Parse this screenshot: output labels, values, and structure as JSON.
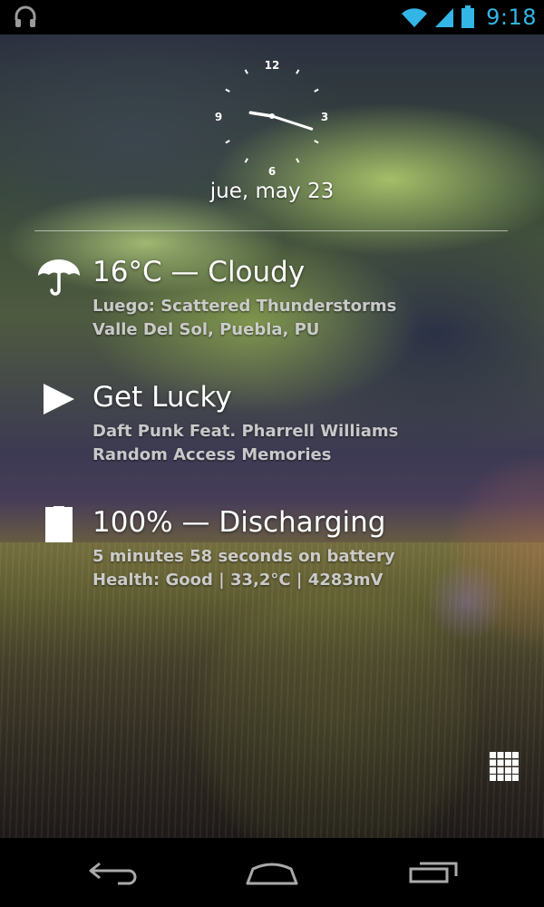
{
  "status_bar": {
    "left_icon": "headphones-icon",
    "right_icons": [
      "wifi-icon",
      "signal-icon",
      "battery-icon"
    ],
    "time": "9:18",
    "accent_color": "#33b5e5"
  },
  "clock": {
    "numbers": [
      "12",
      "3",
      "6",
      "9"
    ],
    "hour": 9,
    "minute": 18
  },
  "date": "jue, may 23",
  "weather": {
    "icon": "umbrella-icon",
    "title": "16°C — Cloudy",
    "line1": "Luego: Scattered Thunderstorms",
    "line2": "Valle Del Sol, Puebla, PU"
  },
  "music": {
    "icon": "play-icon",
    "title": "Get Lucky",
    "line1": "Daft Punk Feat. Pharrell Williams",
    "line2": "Random Access Memories"
  },
  "battery": {
    "icon": "battery-icon",
    "title": "100% — Discharging",
    "line1": "5 minutes 58 seconds on battery",
    "line2": "Health: Good | 33,2°C | 4283mV",
    "level": 1.0
  },
  "apps_button": "apps-grid-icon",
  "nav_bar": [
    "back-icon",
    "home-icon",
    "recent-apps-icon"
  ]
}
